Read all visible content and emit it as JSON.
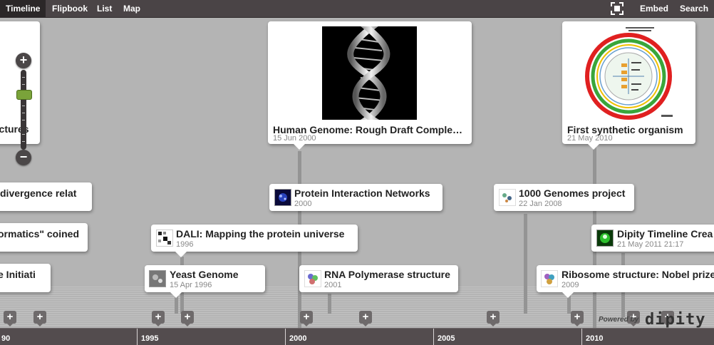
{
  "nav": {
    "tabs": [
      {
        "label": "Timeline",
        "active": true
      },
      {
        "label": "Flipbook"
      },
      {
        "label": "List"
      },
      {
        "label": "Map"
      }
    ],
    "embed_label": "Embed",
    "search_label": "Search",
    "fullscreen_icon": "fullscreen-icon"
  },
  "zoom": {
    "plus": "+",
    "minus": "−",
    "level": 0.72
  },
  "axis": {
    "years": [
      "90",
      "1995",
      "2000",
      "2005",
      "2010"
    ]
  },
  "cards": {
    "partial_structures": {
      "title": "uctures"
    },
    "partial_divergence": {
      "title": "divergence relat"
    },
    "partial_informatics": {
      "title": "ormatics\" coined"
    },
    "partial_initiative": {
      "title": "e Initiati"
    },
    "human_genome": {
      "title": "Human Genome: Rough Draft Comple…",
      "date": "15 Jun 2000"
    },
    "synthetic": {
      "title": "First synthetic organism",
      "date": "21 May 2010"
    },
    "protein_networks": {
      "title": "Protein Interaction Networks",
      "date": "2000"
    },
    "genomes_1000": {
      "title": "1000 Genomes project",
      "date": "22 Jan 2008"
    },
    "dali": {
      "title": "DALI: Mapping the protein universe",
      "date": "1996"
    },
    "dipity": {
      "title": "Dipity Timeline Crea",
      "date": "21 May 2011 21:17"
    },
    "yeast": {
      "title": "Yeast Genome",
      "date": "15 Apr 1996"
    },
    "rna_pol": {
      "title": "RNA Polymerase structure",
      "date": "2001"
    },
    "ribosome": {
      "title": "Ribosome structure: Nobel prize",
      "date": "2009"
    }
  },
  "plus_label": "+",
  "footer": {
    "powered": "Powered by",
    "logo": "dipity"
  },
  "colors": {
    "topbar": "#4a4446",
    "background": "#b4b4b4",
    "axis": "#534c4e",
    "zoom_knob": "#7aa33a"
  }
}
